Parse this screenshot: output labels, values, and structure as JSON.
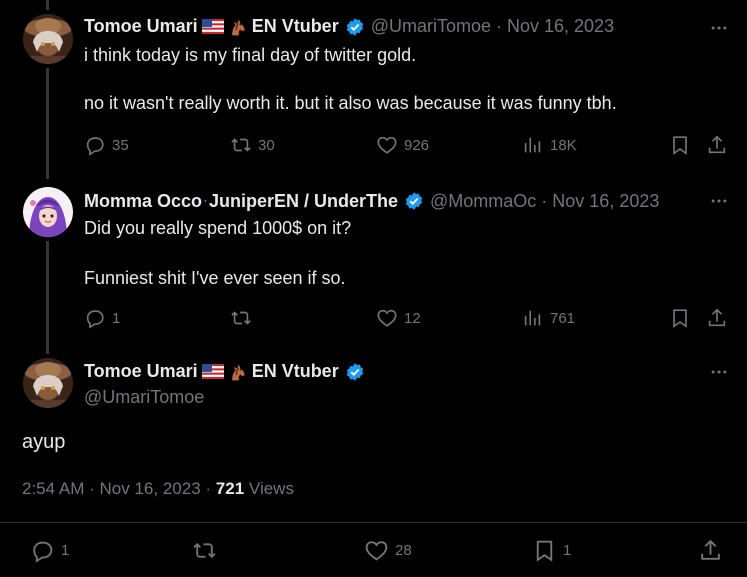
{
  "tweets": [
    {
      "name": "Tomoe Umari",
      "name_suffix": "EN Vtuber",
      "handle": "@UmariTomoe",
      "date": "Nov 16, 2023",
      "text_lines": [
        "i think today is my final day of twitter gold.",
        "no it wasn't really worth it. but it also was because it was funny tbh."
      ],
      "replies": "35",
      "retweets": "30",
      "likes": "926",
      "views": "18K"
    },
    {
      "name": "Momma Occo",
      "name_suffix": "JuniperEN / UnderThe",
      "handle": "@MommaOc",
      "date": "Nov 16, 2023",
      "text_lines": [
        "Did you really spend 1000$ on it?",
        "Funniest shit I've ever seen if so."
      ],
      "replies": "1",
      "retweets": "",
      "likes": "12",
      "views": "761"
    }
  ],
  "main_tweet": {
    "name": "Tomoe Umari",
    "name_suffix": "EN Vtuber",
    "handle": "@UmariTomoe",
    "text": "ayup",
    "time": "2:54 AM",
    "date": "Nov 16, 2023",
    "views_count": "721",
    "views_label": "Views",
    "replies": "1",
    "retweets": "",
    "likes": "28",
    "bookmarks": "1"
  },
  "separator": "·",
  "colors": {
    "background": "#000000",
    "text": "#e7e9ea",
    "muted": "#71767b",
    "verified": "#1d9bf0",
    "divider": "#2f3336"
  },
  "icons": [
    "reply-icon",
    "retweet-icon",
    "like-icon",
    "views-icon",
    "bookmark-icon",
    "share-icon",
    "more-icon",
    "verified-icon",
    "us-flag-icon",
    "horse-icon",
    "octopus-icon"
  ]
}
